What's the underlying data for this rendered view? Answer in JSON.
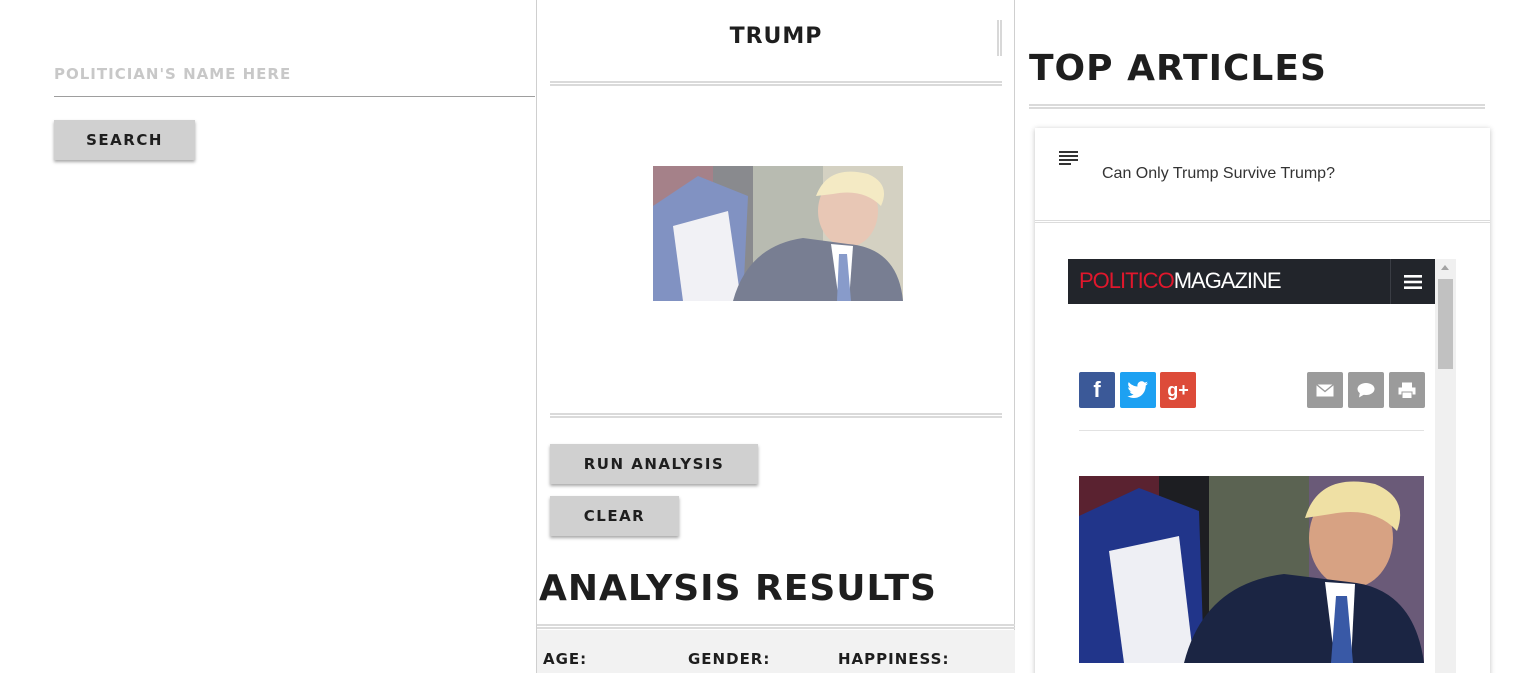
{
  "search": {
    "placeholder": "Politician's name here",
    "button_label": "Search"
  },
  "profile": {
    "name": "Trump",
    "image_alt": "Donald Trump"
  },
  "actions": {
    "run_label": "Run Analysis",
    "clear_label": "Clear"
  },
  "results": {
    "title": "Analysis Results",
    "age_label": "Age:",
    "gender_label": "Gender:",
    "happiness_label": "Happiness:"
  },
  "articles": {
    "title": "Top Articles",
    "items": [
      {
        "title": "Can Only Trump Survive Trump?",
        "icon": "notes-icon",
        "preview": {
          "logo_red": "POLITICO",
          "logo_white": "MAGAZINE",
          "share_buttons": [
            "facebook-icon",
            "twitter-icon",
            "google-plus-icon"
          ],
          "share_glyphs": {
            "facebook": "f",
            "twitter": "",
            "google_plus": "g+"
          },
          "utility_buttons": [
            "mail-icon",
            "comment-icon",
            "print-icon"
          ]
        }
      }
    ]
  },
  "colors": {
    "button_bg": "#d0d0d0",
    "heading": "#1e1e1e",
    "politico_bar": "#22252b",
    "politico_red": "#e0172c",
    "facebook": "#3b5998",
    "twitter": "#1da1f2",
    "google_plus": "#dd4b39",
    "utility_gray": "#9b9b9b"
  }
}
